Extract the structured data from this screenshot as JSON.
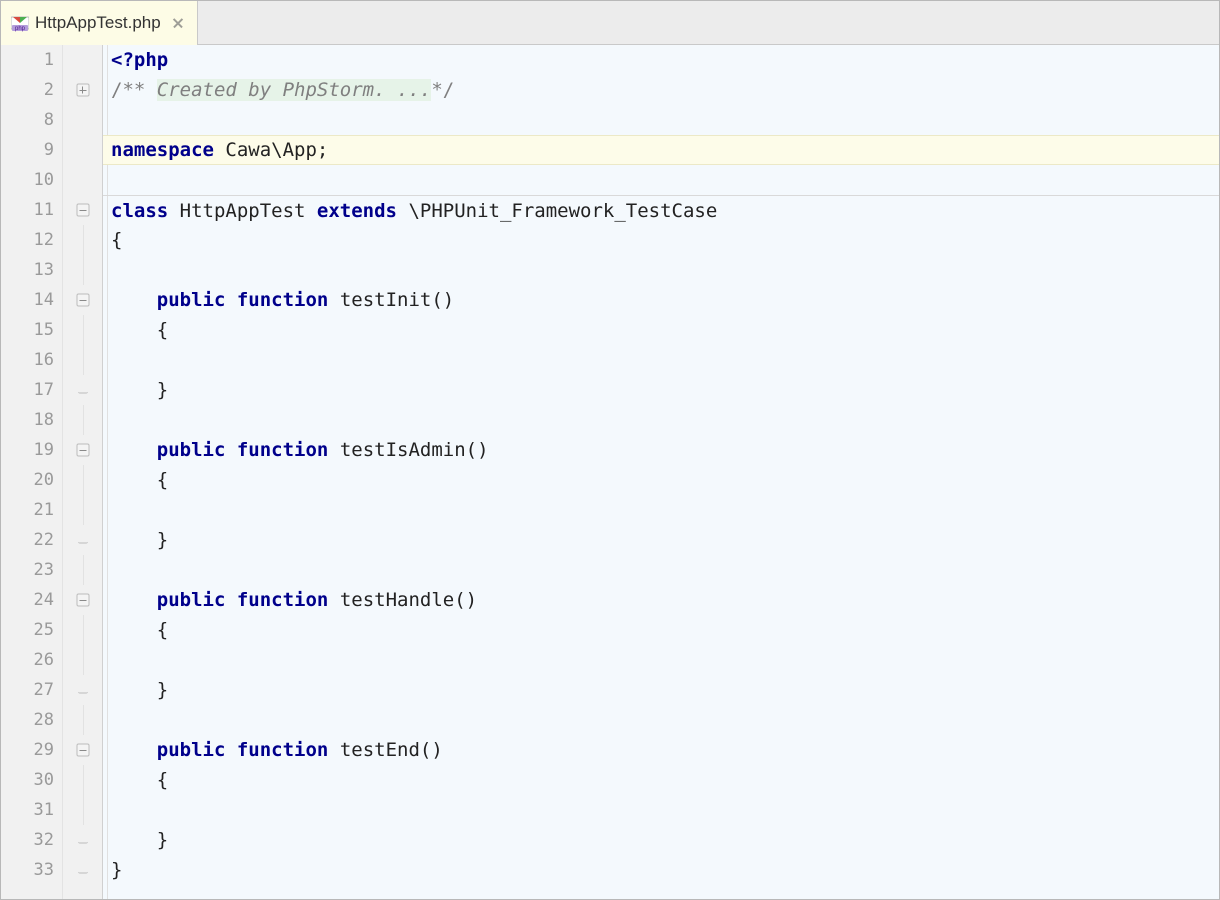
{
  "tab": {
    "filename": "HttpAppTest.php"
  },
  "colors": {
    "accent_bg": "#fdfce6",
    "editor_bg": "#f4f9fd",
    "gutter_bg": "#f1f1f1"
  },
  "lines": [
    {
      "num": "1",
      "fold": "",
      "code": [
        [
          "tag",
          "<?php"
        ]
      ]
    },
    {
      "num": "2",
      "fold": "plus",
      "code": [
        [
          "cmtd",
          "/** "
        ],
        [
          "cmt_fold",
          "Created by PhpStorm. ..."
        ],
        [
          "cmtd",
          "*/"
        ]
      ]
    },
    {
      "num": "8",
      "fold": "",
      "code": []
    },
    {
      "num": "9",
      "fold": "",
      "code": [
        [
          "kw",
          "namespace"
        ],
        [
          "id",
          " Cawa\\App"
        ],
        [
          "punc",
          ";"
        ]
      ],
      "cur": true
    },
    {
      "num": "10",
      "fold": "",
      "code": []
    },
    {
      "num": "11",
      "fold": "minus",
      "code": [
        [
          "kw",
          "class"
        ],
        [
          "id",
          " HttpAppTest "
        ],
        [
          "kw",
          "extends"
        ],
        [
          "id",
          " \\PHPUnit_Framework_TestCase"
        ]
      ],
      "hr": true
    },
    {
      "num": "12",
      "fold": "guide",
      "code": [
        [
          "punc",
          "{"
        ]
      ]
    },
    {
      "num": "13",
      "fold": "guide",
      "code": []
    },
    {
      "num": "14",
      "fold": "minus",
      "code": [
        [
          "id",
          "    "
        ],
        [
          "kw",
          "public"
        ],
        [
          "id",
          " "
        ],
        [
          "kw",
          "function"
        ],
        [
          "id",
          " "
        ],
        [
          "fn",
          "testInit"
        ],
        [
          "punc",
          "()"
        ]
      ]
    },
    {
      "num": "15",
      "fold": "guide",
      "code": [
        [
          "id",
          "    "
        ],
        [
          "punc",
          "{"
        ]
      ]
    },
    {
      "num": "16",
      "fold": "guide",
      "code": []
    },
    {
      "num": "17",
      "fold": "end",
      "code": [
        [
          "id",
          "    "
        ],
        [
          "punc",
          "}"
        ]
      ]
    },
    {
      "num": "18",
      "fold": "guide",
      "code": []
    },
    {
      "num": "19",
      "fold": "minus",
      "code": [
        [
          "id",
          "    "
        ],
        [
          "kw",
          "public"
        ],
        [
          "id",
          " "
        ],
        [
          "kw",
          "function"
        ],
        [
          "id",
          " "
        ],
        [
          "fn",
          "testIsAdmin"
        ],
        [
          "punc",
          "()"
        ]
      ]
    },
    {
      "num": "20",
      "fold": "guide",
      "code": [
        [
          "id",
          "    "
        ],
        [
          "punc",
          "{"
        ]
      ]
    },
    {
      "num": "21",
      "fold": "guide",
      "code": []
    },
    {
      "num": "22",
      "fold": "end",
      "code": [
        [
          "id",
          "    "
        ],
        [
          "punc",
          "}"
        ]
      ]
    },
    {
      "num": "23",
      "fold": "guide",
      "code": []
    },
    {
      "num": "24",
      "fold": "minus",
      "code": [
        [
          "id",
          "    "
        ],
        [
          "kw",
          "public"
        ],
        [
          "id",
          " "
        ],
        [
          "kw",
          "function"
        ],
        [
          "id",
          " "
        ],
        [
          "fn",
          "testHandle"
        ],
        [
          "punc",
          "()"
        ]
      ]
    },
    {
      "num": "25",
      "fold": "guide",
      "code": [
        [
          "id",
          "    "
        ],
        [
          "punc",
          "{"
        ]
      ]
    },
    {
      "num": "26",
      "fold": "guide",
      "code": []
    },
    {
      "num": "27",
      "fold": "end",
      "code": [
        [
          "id",
          "    "
        ],
        [
          "punc",
          "}"
        ]
      ]
    },
    {
      "num": "28",
      "fold": "guide",
      "code": []
    },
    {
      "num": "29",
      "fold": "minus",
      "code": [
        [
          "id",
          "    "
        ],
        [
          "kw",
          "public"
        ],
        [
          "id",
          " "
        ],
        [
          "kw",
          "function"
        ],
        [
          "id",
          " "
        ],
        [
          "fn",
          "testEnd"
        ],
        [
          "punc",
          "()"
        ]
      ]
    },
    {
      "num": "30",
      "fold": "guide",
      "code": [
        [
          "id",
          "    "
        ],
        [
          "punc",
          "{"
        ]
      ]
    },
    {
      "num": "31",
      "fold": "guide",
      "code": []
    },
    {
      "num": "32",
      "fold": "end",
      "code": [
        [
          "id",
          "    "
        ],
        [
          "punc",
          "}"
        ]
      ]
    },
    {
      "num": "33",
      "fold": "end",
      "code": [
        [
          "punc",
          "}"
        ]
      ]
    }
  ]
}
